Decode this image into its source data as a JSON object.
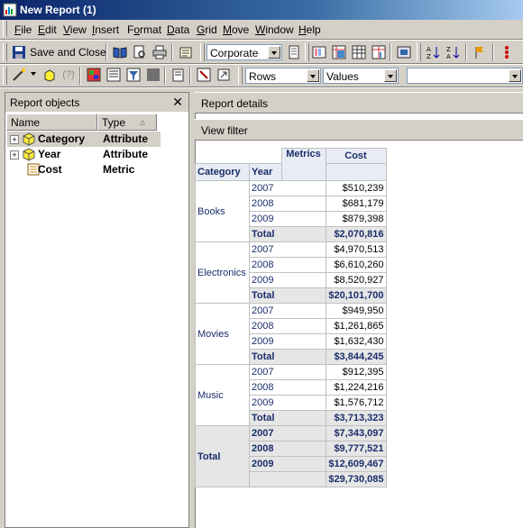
{
  "window": {
    "title": "New Report (1)"
  },
  "menu": [
    "File",
    "Edit",
    "View",
    "Insert",
    "Format",
    "Data",
    "Grid",
    "Move",
    "Window",
    "Help"
  ],
  "menu_underline": [
    "F",
    "E",
    "V",
    "I",
    "o",
    "D",
    "G",
    "M",
    "W",
    "H"
  ],
  "toolbar": {
    "save_label": "Save and Close",
    "template_combo": "Corporate",
    "rows_combo": "Rows",
    "values_combo": "Values",
    "blank_combo": ""
  },
  "left_panel": {
    "title": "Report objects",
    "col_name": "Name",
    "col_type": "Type",
    "objects": [
      {
        "name": "Category",
        "type": "Attribute",
        "expandable": true,
        "icon": "attribute-icon"
      },
      {
        "name": "Year",
        "type": "Attribute",
        "expandable": true,
        "icon": "attribute-icon"
      },
      {
        "name": "Cost",
        "type": "Metric",
        "expandable": false,
        "icon": "metric-icon"
      }
    ]
  },
  "right_panel": {
    "details_label": "Report details",
    "filter_label": "View filter"
  },
  "grid": {
    "metrics_label": "Metrics",
    "metric_name": "Cost",
    "row_header_1": "Category",
    "row_header_2": "Year",
    "groups": [
      {
        "category": "Books",
        "rows": [
          [
            "2007",
            "$510,239"
          ],
          [
            "2008",
            "$681,179"
          ],
          [
            "2009",
            "$879,398"
          ]
        ],
        "total_label": "Total",
        "total": "$2,070,816"
      },
      {
        "category": "Electronics",
        "rows": [
          [
            "2007",
            "$4,970,513"
          ],
          [
            "2008",
            "$6,610,260"
          ],
          [
            "2009",
            "$8,520,927"
          ]
        ],
        "total_label": "Total",
        "total": "$20,101,700"
      },
      {
        "category": "Movies",
        "rows": [
          [
            "2007",
            "$949,950"
          ],
          [
            "2008",
            "$1,261,865"
          ],
          [
            "2009",
            "$1,632,430"
          ]
        ],
        "total_label": "Total",
        "total": "$3,844,245"
      },
      {
        "category": "Music",
        "rows": [
          [
            "2007",
            "$912,395"
          ],
          [
            "2008",
            "$1,224,216"
          ],
          [
            "2009",
            "$1,576,712"
          ]
        ],
        "total_label": "Total",
        "total": "$3,713,323"
      }
    ],
    "grand_total": {
      "label": "Total",
      "rows": [
        [
          "2007",
          "$7,343,097"
        ],
        [
          "2008",
          "$9,777,521"
        ],
        [
          "2009",
          "$12,609,467"
        ]
      ],
      "overall": "$29,730,085"
    }
  }
}
